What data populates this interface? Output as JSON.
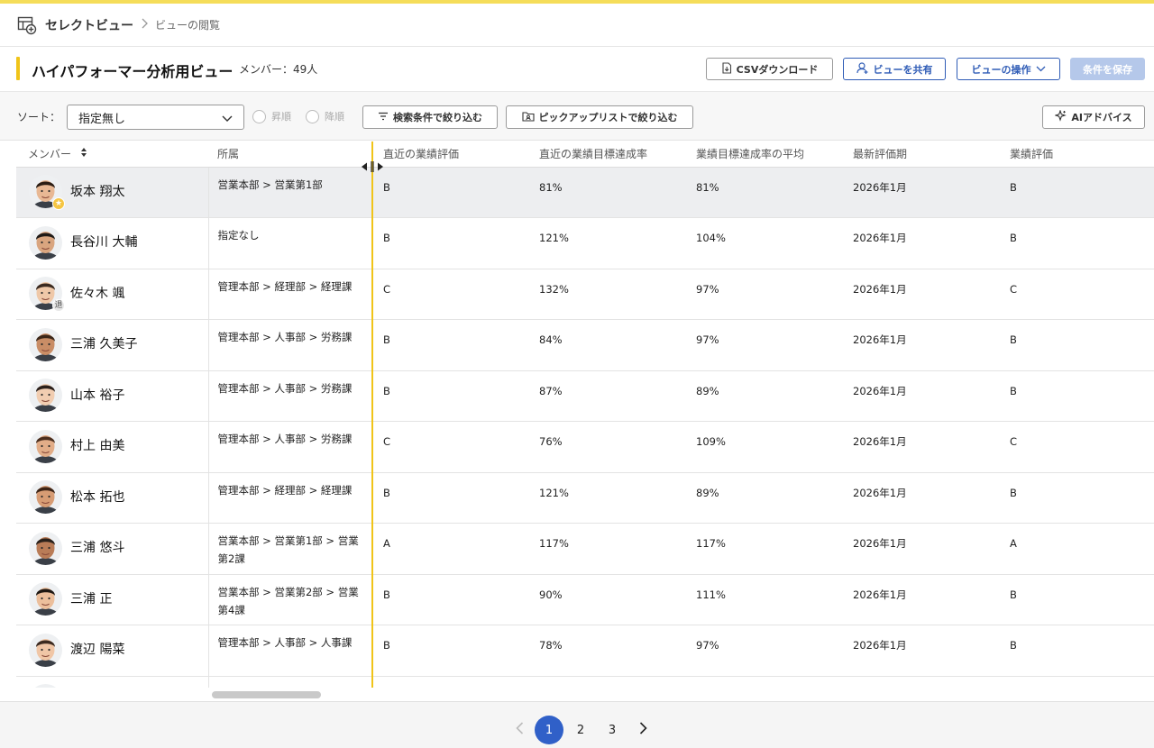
{
  "breadcrumb": {
    "root": "セレクトビュー",
    "current": "ビューの閲覧"
  },
  "header": {
    "title": "ハイパフォーマー分析用ビュー",
    "member_count": "メンバー：49人",
    "csv_label": "CSVダウンロード",
    "share_label": "ビューを共有",
    "ops_label": "ビューの操作",
    "save_label": "条件を保存"
  },
  "filters": {
    "sort_label": "ソート：",
    "sort_value": "指定無し",
    "asc_label": "昇順",
    "desc_label": "降順",
    "search_filter_label": "検索条件で絞り込む",
    "pick_filter_label": "ピックアップリストで絞り込む",
    "ai_label": "AIアドバイス"
  },
  "table": {
    "columns": [
      "メンバー",
      "所属",
      "直近の業績評価",
      "直近の業績目標達成率",
      "業績目標達成率の平均",
      "最新評価期",
      "業績評価"
    ],
    "rows": [
      {
        "name": "坂本 翔太",
        "dept": "営業本部 > 営業第1部",
        "recent_eval": "B",
        "recent_rate": "81%",
        "avg_rate": "81%",
        "period": "2026年1月",
        "eval": "B",
        "badge": "★"
      },
      {
        "name": "長谷川 大輔",
        "dept": "指定なし",
        "recent_eval": "B",
        "recent_rate": "121%",
        "avg_rate": "104%",
        "period": "2026年1月",
        "eval": "B",
        "badge": ""
      },
      {
        "name": "佐々木 颯",
        "dept": "管理本部 > 経理部 > 経理課",
        "recent_eval": "C",
        "recent_rate": "132%",
        "avg_rate": "97%",
        "period": "2026年1月",
        "eval": "C",
        "badge": "退"
      },
      {
        "name": "三浦 久美子",
        "dept": "管理本部 > 人事部 > 労務課",
        "recent_eval": "B",
        "recent_rate": "84%",
        "avg_rate": "97%",
        "period": "2026年1月",
        "eval": "B",
        "badge": ""
      },
      {
        "name": "山本 裕子",
        "dept": "管理本部 > 人事部 > 労務課",
        "recent_eval": "B",
        "recent_rate": "87%",
        "avg_rate": "89%",
        "period": "2026年1月",
        "eval": "B",
        "badge": ""
      },
      {
        "name": "村上 由美",
        "dept": "管理本部 > 人事部 > 労務課",
        "recent_eval": "C",
        "recent_rate": "76%",
        "avg_rate": "109%",
        "period": "2026年1月",
        "eval": "C",
        "badge": ""
      },
      {
        "name": "松本 拓也",
        "dept": "管理本部 > 経理部 > 経理課",
        "recent_eval": "B",
        "recent_rate": "121%",
        "avg_rate": "89%",
        "period": "2026年1月",
        "eval": "B",
        "badge": ""
      },
      {
        "name": "三浦 悠斗",
        "dept": "営業本部 > 営業第1部 > 営業第2課",
        "recent_eval": "A",
        "recent_rate": "117%",
        "avg_rate": "117%",
        "period": "2026年1月",
        "eval": "A",
        "badge": ""
      },
      {
        "name": "三浦 正",
        "dept": "営業本部 > 営業第2部 > 営業第4課",
        "recent_eval": "B",
        "recent_rate": "90%",
        "avg_rate": "111%",
        "period": "2026年1月",
        "eval": "B",
        "badge": ""
      },
      {
        "name": "渡辺 陽菜",
        "dept": "管理本部 > 人事部 > 人事課",
        "recent_eval": "B",
        "recent_rate": "78%",
        "avg_rate": "97%",
        "period": "2026年1月",
        "eval": "B",
        "badge": ""
      }
    ]
  },
  "pagination": {
    "pages": [
      "1",
      "2",
      "3"
    ],
    "current": "1"
  },
  "colors": {
    "accent_yellow": "#f0c419",
    "primary_blue": "#2f5cb6",
    "selected_row": "#edeef0"
  }
}
